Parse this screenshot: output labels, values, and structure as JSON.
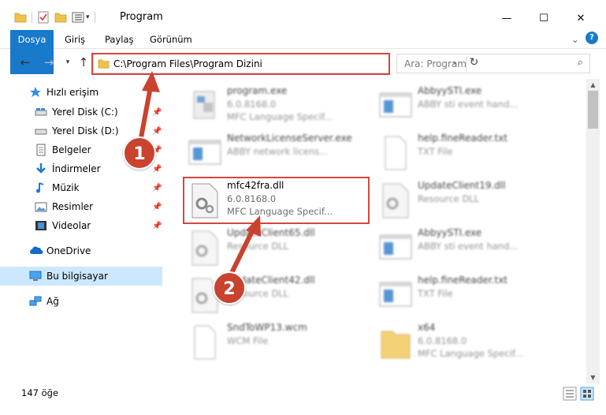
{
  "window": {
    "title": "Program",
    "minimize_glyph": "—",
    "maximize_glyph": "☐",
    "close_glyph": "✕"
  },
  "ribbon": {
    "tabs": [
      "Dosya",
      "Giriş",
      "Paylaş",
      "Görünüm"
    ],
    "help_glyph": "?",
    "expand_glyph": "⌄"
  },
  "navigation": {
    "address_path": "C:\\Program Files\\Program Dizini",
    "search_placeholder": "Ara: Program"
  },
  "sidebar": {
    "items": [
      {
        "label": "Hızlı erişim",
        "icon": "star-icon"
      },
      {
        "label": "Yerel Disk (C:)",
        "icon": "drive-icon",
        "pinned": true
      },
      {
        "label": "Yerel Disk (D:)",
        "icon": "drive-icon",
        "pinned": true
      },
      {
        "label": "Belgeler",
        "icon": "documents-icon",
        "pinned": true
      },
      {
        "label": "İndirmeler",
        "icon": "download-icon",
        "pinned": true
      },
      {
        "label": "Müzik",
        "icon": "music-icon",
        "pinned": true
      },
      {
        "label": "Resimler",
        "icon": "pictures-icon",
        "pinned": true
      },
      {
        "label": "Videolar",
        "icon": "video-icon",
        "pinned": true
      },
      {
        "label": "OneDrive",
        "icon": "cloud-icon"
      },
      {
        "label": "Bu bilgisayar",
        "icon": "computer-icon",
        "selected": true
      },
      {
        "label": "Ağ",
        "icon": "network-icon"
      }
    ]
  },
  "files": [
    {
      "name": "program.exe",
      "line2": "6.0.8168.0",
      "line3": "MFC Language Specif...",
      "icon": "exe-icon",
      "blurred": true
    },
    {
      "name": "AbbyySTI.exe",
      "line2": "ABBY sti event hand...",
      "line3": "",
      "icon": "app-window-icon",
      "blurred": true
    },
    {
      "name": "NetworkLicenseServer.exe",
      "line2": "ABBY network licens...",
      "line3": "",
      "icon": "app-window-icon",
      "blurred": true
    },
    {
      "name": "help.fineReader.txt",
      "line2": "TXT File",
      "line3": "",
      "icon": "text-file-icon",
      "blurred": true
    },
    {
      "name": "mfc42fra.dll",
      "line2": "6.0.8168.0",
      "line3": "MFC Language Specif...",
      "icon": "dll-gear-icon",
      "blurred": false
    },
    {
      "name": "UpdateClient19.dll",
      "line2": "Resource DLL",
      "line3": "",
      "icon": "dll-gear-icon",
      "blurred": true
    },
    {
      "name": "UpdateClient65.dll",
      "line2": "Resource DLL",
      "line3": "",
      "icon": "dll-gear-icon",
      "blurred": true
    },
    {
      "name": "AbbyySTI.exe",
      "line2": "ABBY sti event hand...",
      "line3": "",
      "icon": "app-window-icon",
      "blurred": true
    },
    {
      "name": "UpdateClient42.dll",
      "line2": "Resource DLL",
      "line3": "",
      "icon": "dll-gear-icon",
      "blurred": true
    },
    {
      "name": "help.fineReader.txt",
      "line2": "TXT File",
      "line3": "",
      "icon": "text-file-icon",
      "blurred": true
    },
    {
      "name": "SndToWP13.wcm",
      "line2": "WCM File",
      "line3": "",
      "icon": "blank-file-icon",
      "blurred": true
    },
    {
      "name": "x64",
      "line2": "6.0.8168.0",
      "line3": "MFC Language Specif...",
      "icon": "folder-icon",
      "blurred": true
    }
  ],
  "annotations": {
    "step1": "1",
    "step2": "2",
    "highlight_color": "#d6463e",
    "badge_color": "#c9432f"
  },
  "status": {
    "item_count": "147 öğe"
  },
  "colors": {
    "accent": "#1979ca",
    "selection": "#cce8ff"
  }
}
